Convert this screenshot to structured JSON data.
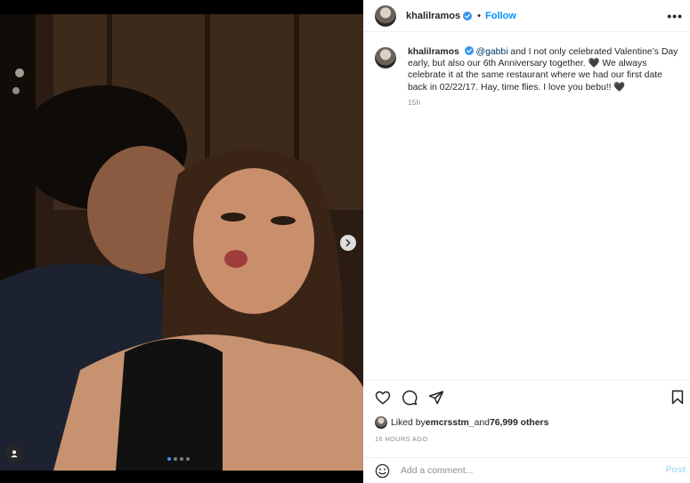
{
  "post": {
    "username": "khalilramos",
    "follow_label": "Follow",
    "separator": "•",
    "more_label": "•••",
    "caption": {
      "username": "khalilramos",
      "mention": "@gabbi",
      "text": " and I not only celebrated Valentine’s Day early, but also our 6th Anniversary together. 🖤 We always celebrate it at the same restaurant where we had our first date back in 02/22/17. Hay, time flies. I love you bebu!! 🖤",
      "time": "15h"
    },
    "likes": {
      "prefix": "Liked by ",
      "user": "emcrsstm_",
      "middle": " and ",
      "others": "76,999 others"
    },
    "timestamp": "16 HOURS AGO",
    "comment": {
      "placeholder": "Add a comment...",
      "post_label": "Post"
    },
    "carousel": {
      "slides": 4,
      "current": 1
    }
  },
  "colors": {
    "accent": "#0095f6",
    "post_disabled": "#b2dffc",
    "muted": "#8e8e8e",
    "border": "#efefef"
  },
  "icons": [
    "next-arrow-icon",
    "user-tag-icon",
    "verified-icon",
    "more-icon",
    "heart-icon",
    "comment-icon",
    "share-icon",
    "bookmark-icon",
    "emoji-icon"
  ]
}
